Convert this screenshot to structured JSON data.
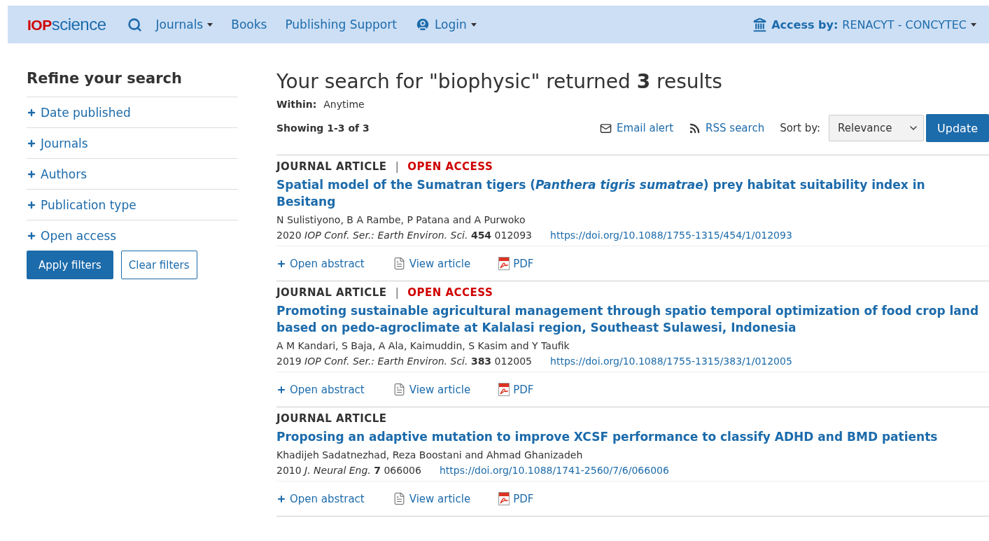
{
  "header": {
    "logo": {
      "brand": "IOP",
      "name": "science"
    },
    "nav": [
      {
        "kind": "search"
      },
      {
        "kind": "dropdown",
        "label": "Journals"
      },
      {
        "kind": "link",
        "label": "Books"
      },
      {
        "kind": "link",
        "label": "Publishing Support"
      },
      {
        "kind": "login",
        "label": "Login"
      }
    ],
    "access": {
      "label": "Access by:",
      "value": "RENACYT - CONCYTEC"
    }
  },
  "sidebar": {
    "title": "Refine your search",
    "filters": [
      {
        "label": "Date published",
        "expanded": false
      },
      {
        "label": "Journals",
        "expanded": false
      },
      {
        "label": "Authors",
        "expanded": false
      },
      {
        "label": "Publication type",
        "expanded": false
      },
      {
        "label": "Open access",
        "expanded": false
      }
    ],
    "apply": "Apply filters",
    "clear": "Clear filters"
  },
  "main": {
    "heading": "Your search for \"biophysic\" returned **3** results",
    "within": {
      "label": "Within:",
      "value": "Anytime"
    },
    "showing": "Showing 1-3 of 3",
    "tools": [
      {
        "kind": "email",
        "label": "Email alert"
      },
      {
        "kind": "rss",
        "label": "RSS search"
      }
    ],
    "sort": {
      "label": "Sort by:",
      "value": "Relevance"
    },
    "update": "Update",
    "results": [
      {
        "type": "JOURNAL ARTICLE",
        "separator": "|",
        "access": "OPEN ACCESS",
        "title": "Spatial model of the Sumatran tigers (*Panthera tigris sumatrae*) prey habitat suitability index in Besitang",
        "authors": "N Sulistiyono, B A Rambe, P Patana and A Purwoko",
        "citation": "2020 *IOP Conf. Ser.: Earth Environ. Sci.* **454** 012093",
        "doi": "https://doi.org/10.1088/1755-1315/454/1/012093",
        "actions": [
          {
            "kind": "abstract",
            "label": "Open abstract"
          },
          {
            "kind": "view",
            "label": "View article"
          },
          {
            "kind": "pdf",
            "label": "PDF"
          }
        ]
      },
      {
        "type": "JOURNAL ARTICLE",
        "separator": "|",
        "access": "OPEN ACCESS",
        "title": "Promoting sustainable agricultural management through spatio temporal optimization of food crop land based on pedo-agroclimate at Kalalasi region, Southeast Sulawesi, Indonesia",
        "authors": "A M Kandari, S Baja, A Ala, Kaimuddin, S Kasim and Y Taufik",
        "citation": "2019 *IOP Conf. Ser.: Earth Environ. Sci.* **383** 012005",
        "doi": "https://doi.org/10.1088/1755-1315/383/1/012005",
        "actions": [
          {
            "kind": "abstract",
            "label": "Open abstract"
          },
          {
            "kind": "view",
            "label": "View article"
          },
          {
            "kind": "pdf",
            "label": "PDF"
          }
        ]
      },
      {
        "type": "JOURNAL ARTICLE",
        "title": "Proposing an adaptive mutation to improve XCSF performance to classify ADHD and BMD patients",
        "authors": "Khadijeh Sadatnezhad, Reza Boostani and Ahmad Ghanizadeh",
        "citation": "2010 *J. Neural Eng.* **7** 066006",
        "doi": "https://doi.org/10.1088/1741-2560/7/6/066006",
        "actions": [
          {
            "kind": "abstract",
            "label": "Open abstract"
          },
          {
            "kind": "view",
            "label": "View article"
          },
          {
            "kind": "pdf",
            "label": "PDF"
          }
        ]
      }
    ]
  }
}
